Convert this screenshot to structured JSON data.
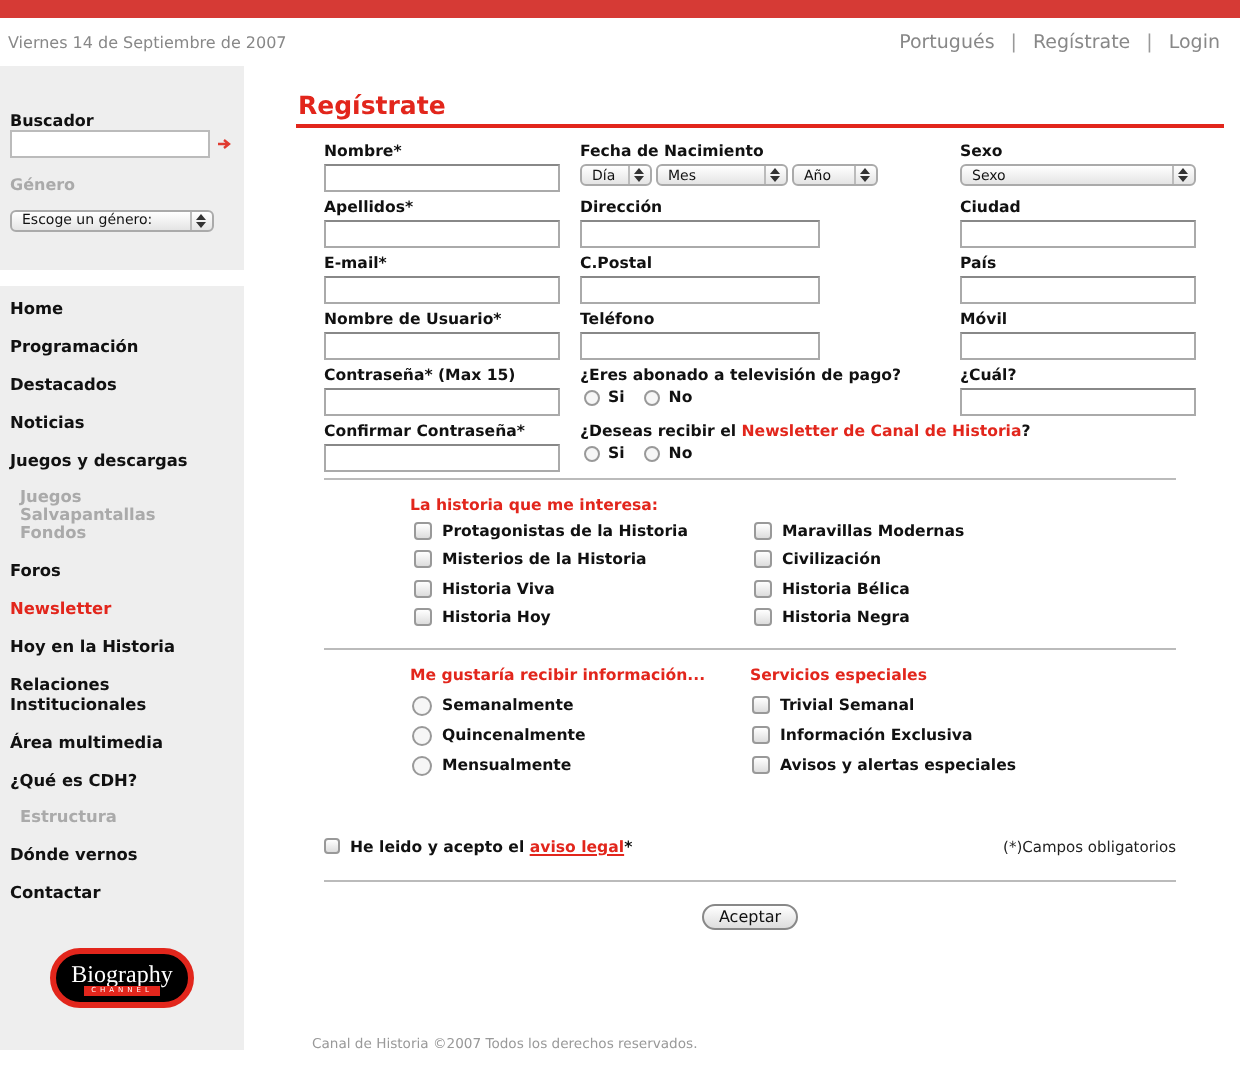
{
  "header": {
    "date": "Viernes 14 de Septiembre de 2007",
    "separator": "|",
    "links": [
      {
        "label": "Portugués"
      },
      {
        "label": "Regístrate"
      },
      {
        "label": "Login"
      }
    ]
  },
  "sidebar": {
    "search": {
      "label": "Buscador"
    },
    "genre": {
      "label": "Género",
      "select": "Escoge un género:"
    },
    "nav": [
      {
        "label": "Home",
        "kind": "main",
        "selected": false
      },
      {
        "label": "Programación",
        "kind": "main",
        "selected": false
      },
      {
        "label": "Destacados",
        "kind": "main",
        "selected": false
      },
      {
        "label": "Noticias",
        "kind": "main",
        "selected": false
      },
      {
        "label": "Juegos y descargas",
        "kind": "main",
        "selected": false
      },
      {
        "label": "Juegos",
        "kind": "sub",
        "selected": false
      },
      {
        "label": "Salvapantallas",
        "kind": "sub",
        "selected": false
      },
      {
        "label": "Fondos",
        "kind": "sub",
        "selected": false
      },
      {
        "label": "Foros",
        "kind": "main",
        "selected": false
      },
      {
        "label": "Newsletter",
        "kind": "main",
        "selected": true
      },
      {
        "label": "Hoy en la Historia",
        "kind": "main",
        "selected": false
      },
      {
        "label": "Relaciones Institucionales",
        "kind": "main",
        "selected": false
      },
      {
        "label": "Área multimedia",
        "kind": "main",
        "selected": false
      },
      {
        "label": "¿Qué es CDH?",
        "kind": "main",
        "selected": false
      },
      {
        "label": "Estructura",
        "kind": "sub",
        "selected": false
      },
      {
        "label": "Dónde vernos",
        "kind": "main",
        "selected": false
      },
      {
        "label": "Contactar",
        "kind": "main",
        "selected": false
      }
    ],
    "logo": {
      "text": "Biography",
      "subtext": "CHANNEL"
    }
  },
  "form": {
    "title": "Regístrate",
    "rows": [
      [
        {
          "kind": "text",
          "label": "Nombre*"
        },
        {
          "kind": "date",
          "label": "Fecha de Nacimiento",
          "selects": [
            "Día",
            "Mes",
            "Año"
          ]
        },
        {
          "kind": "select",
          "label": "Sexo",
          "value": "Sexo"
        }
      ],
      [
        {
          "kind": "text",
          "label": "Apellidos*"
        },
        {
          "kind": "text",
          "label": "Dirección"
        },
        {
          "kind": "text",
          "label": "Ciudad"
        }
      ],
      [
        {
          "kind": "text",
          "label": "E-mail*"
        },
        {
          "kind": "text",
          "label": "C.Postal"
        },
        {
          "kind": "text",
          "label": "País"
        }
      ],
      [
        {
          "kind": "text",
          "label": "Nombre de Usuario*"
        },
        {
          "kind": "text",
          "label": "Teléfono"
        },
        {
          "kind": "text",
          "label": "Móvil"
        }
      ],
      [
        {
          "kind": "text",
          "label": "Contraseña* (Max 15)"
        },
        {
          "kind": "radio",
          "label": "¿Eres abonado a televisión de pago?",
          "options": [
            {
              "label": "Si",
              "selected": false
            },
            {
              "label": "No",
              "selected": false
            }
          ]
        },
        {
          "kind": "text",
          "label": "¿Cuál?"
        }
      ],
      [
        {
          "kind": "text",
          "label": "Confirmar Contraseña*"
        },
        {
          "kind": "radio",
          "label": "¿Deseas recibir el ",
          "link": "Newsletter de Canal de Historia",
          "after": "?",
          "options": [
            {
              "label": "Si",
              "selected": false
            },
            {
              "label": "No",
              "selected": false
            }
          ]
        }
      ]
    ],
    "interests": {
      "title": "La historia que me interesa:",
      "items": [
        {
          "label": "Protagonistas de la Historia",
          "checked": false
        },
        {
          "label": "Maravillas Modernas",
          "checked": false
        },
        {
          "label": "Misterios de la Historia",
          "checked": false
        },
        {
          "label": "Civilización",
          "checked": false
        },
        {
          "label": "Historia Viva",
          "checked": false
        },
        {
          "label": "Historia Bélica",
          "checked": false
        },
        {
          "label": "Historia Hoy",
          "checked": false
        },
        {
          "label": "Historia Negra",
          "checked": false
        }
      ]
    },
    "frequency": {
      "title": "Me gustaría recibir información...",
      "options": [
        {
          "label": "Semanalmente",
          "selected": false
        },
        {
          "label": "Quincenalmente",
          "selected": false
        },
        {
          "label": "Mensualmente",
          "selected": false
        }
      ]
    },
    "services": {
      "title": "Servicios especiales",
      "items": [
        {
          "label": "Trivial Semanal",
          "checked": false
        },
        {
          "label": "Información Exclusiva",
          "checked": false
        },
        {
          "label": "Avisos y alertas especiales",
          "checked": false
        }
      ]
    },
    "legal": {
      "checked": false,
      "text": "He leido y acepto el ",
      "link": "aviso legal",
      "after": "*"
    },
    "required_note": "(*)Campos obligatorios",
    "submit": "Aceptar"
  },
  "footer": "Canal de Historia ©2007 Todos los derechos reservados."
}
